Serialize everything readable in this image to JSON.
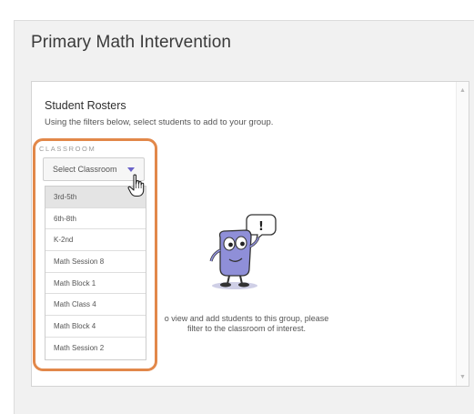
{
  "page": {
    "title": "Primary Math Intervention"
  },
  "roster": {
    "title": "Student Rosters",
    "subtitle": "Using the filters below, select students to add to your group."
  },
  "filter": {
    "label": "CLASSROOM",
    "placeholder": "Select Classroom",
    "options": [
      "3rd-5th",
      "6th-8th",
      "K-2nd",
      "Math Session 8",
      "Math Block 1",
      "Math Class 4",
      "Math Block 4",
      "Math Session 2"
    ],
    "highlighted_option": "3rd-5th"
  },
  "empty_state": {
    "line1": "o view and add students to this group, please",
    "line2": "filter to the classroom of interest.",
    "mascot_bubble": "!"
  },
  "colors": {
    "highlight_ring": "#e2884a",
    "caret": "#6b63c9",
    "mascot_body": "#8f8fd8"
  },
  "icons": {
    "caret": "caret-down-icon",
    "cursor": "hand-pointer-icon",
    "scroll_up": "scroll-up-arrow-icon",
    "scroll_down": "scroll-down-arrow-icon"
  }
}
